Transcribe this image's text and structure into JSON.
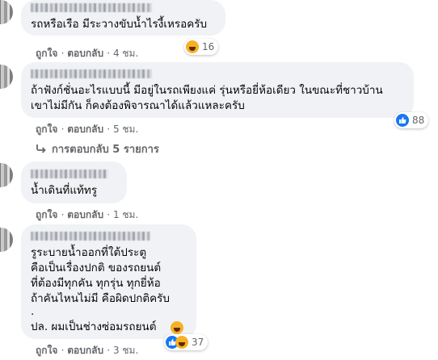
{
  "comments": [
    {
      "text": "รถหรือเรือ มีระวางขับน้ำไรงี้เหรอครับ",
      "actions": {
        "like": "ถูกใจ",
        "reply": "ตอบกลับ",
        "time": "4 ชม."
      },
      "reaction_type": "haha-icon",
      "reaction_count": "16"
    },
    {
      "text_lines": [
        "ถ้าฟังก์ชั่นอะไรแบบนี้ มีอยู่ในรถเพียงแค่ รุ่นหรือยี่ห้อเดียว ในขณะที่ชาวบ้าน",
        "เขาไม่มีกัน ก็คงต้องพิจารณาได้แล้วแหละครับ"
      ],
      "actions": {
        "like": "ถูกใจ",
        "reply": "ตอบกลับ",
        "time": "5 ชม."
      },
      "reaction_type": "like-icon",
      "reaction_count": "88",
      "replies_label": "การตอบกลับ 5 รายการ"
    },
    {
      "text": "น้ำเดินที่แท้ทรู",
      "actions": {
        "like": "ถูกใจ",
        "reply": "ตอบกลับ",
        "time": "1 ชม."
      }
    },
    {
      "text_lines": [
        "รูระบายน้ำออกที่ใต้ประตู",
        "คือเป็นเรื่องปกติ ของรถยนต์",
        "ที่ต้องมีทุกคัน ทุกรุ่น ทุกยี่ห้อ",
        "ถ้าคันไหนไม่มี คือผิดปกติครับ",
        ".",
        "ปล. ผมเป็นช่างซ่อมรถยนต์"
      ],
      "actions": {
        "like": "ถูกใจ",
        "reply": "ตอบกลับ",
        "time": "3 ชม."
      },
      "reaction_type": "like-haha-icons",
      "reaction_count": "37"
    }
  ],
  "separator": "·"
}
